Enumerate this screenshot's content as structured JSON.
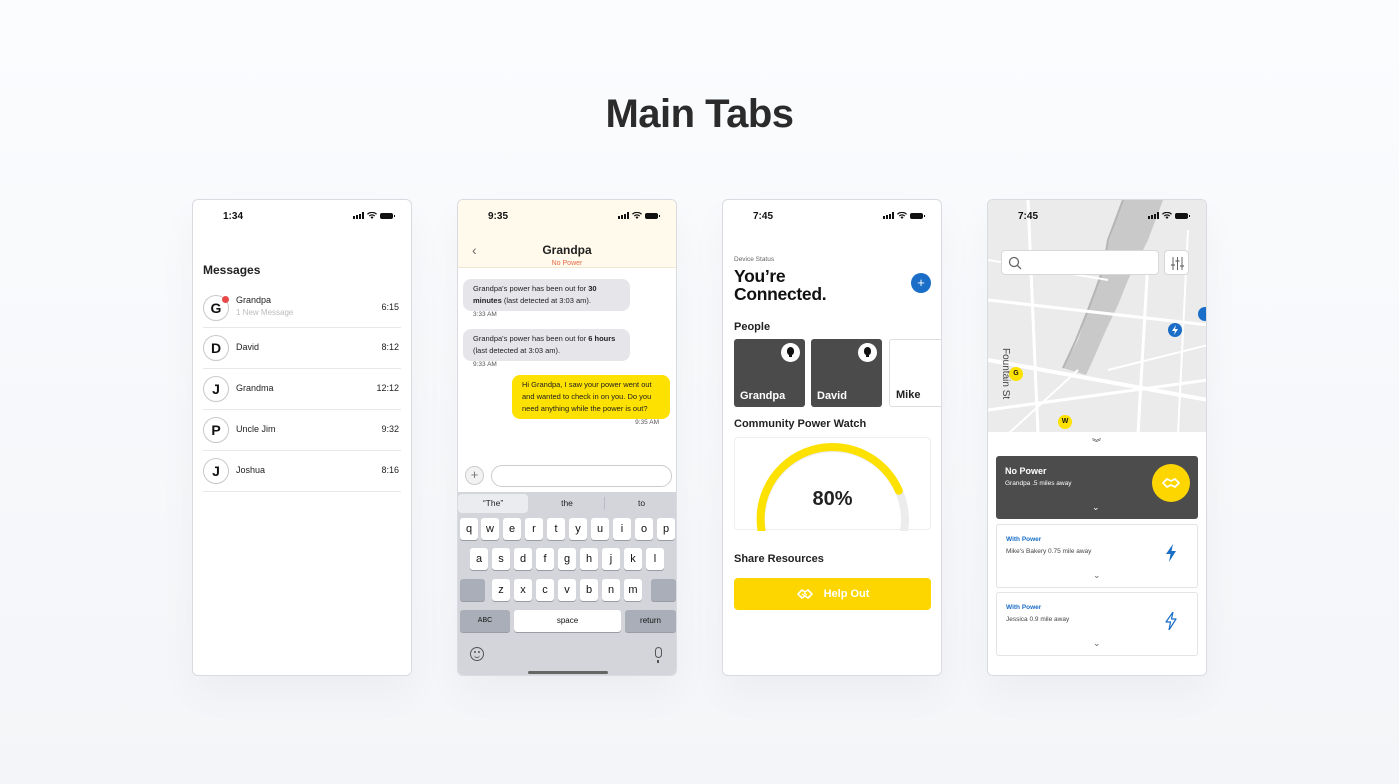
{
  "headline": "Main Tabs",
  "colors": {
    "accent_yellow": "#fde100",
    "accent_blue": "#1a6ec7",
    "dark_card": "#4b4b4b",
    "alert_red": "#e84848"
  },
  "messages_screen": {
    "time": "1:34",
    "title": "Messages",
    "conversations": [
      {
        "initial": "G",
        "name": "Grandpa",
        "subtitle": "1 New Message",
        "time": "6:15",
        "unread": true
      },
      {
        "initial": "D",
        "name": "David",
        "time": "8:12"
      },
      {
        "initial": "J",
        "name": "Grandma",
        "time": "12:12"
      },
      {
        "initial": "P",
        "name": "Uncle Jim",
        "time": "9:32"
      },
      {
        "initial": "J",
        "name": "Joshua",
        "time": "8:16"
      }
    ]
  },
  "chat_screen": {
    "time": "9:35",
    "back_icon": "chevron-left-icon",
    "contact": "Grandpa",
    "status": "No Power",
    "messages": [
      {
        "pre": "Grandpa's power has been out for ",
        "bold": "30 minutes",
        "post": " (last detected at 3:03 am).",
        "time": "3:33 AM"
      },
      {
        "pre": "Grandpa's power has been out for ",
        "bold": "6 hours",
        "post": " (last detected at 3:03 am).",
        "time": "9:33 AM"
      },
      {
        "text": "Hi Grandpa, I saw your power went out and wanted to check in on you. Do you need anything while the power is out?",
        "time": "9:35 AM"
      }
    ],
    "suggestions": [
      "“The”",
      "the",
      "to"
    ],
    "keys": {
      "row1": [
        "q",
        "w",
        "e",
        "r",
        "t",
        "y",
        "u",
        "i",
        "o",
        "p"
      ],
      "row2": [
        "a",
        "s",
        "d",
        "f",
        "g",
        "h",
        "j",
        "k",
        "l"
      ],
      "row3": [
        "z",
        "x",
        "c",
        "v",
        "b",
        "n",
        "m"
      ],
      "abc": "ABC",
      "space": "space",
      "return": "return"
    }
  },
  "status_screen": {
    "time": "7:45",
    "device_label": "Device Status",
    "headline_line1": "You’re",
    "headline_line2": "Connected.",
    "people_title": "People",
    "people": [
      {
        "name": "Grandpa",
        "power": true
      },
      {
        "name": "David",
        "power": true
      },
      {
        "name": "Mike",
        "power": false
      }
    ],
    "community_title": "Community Power Watch",
    "gauge_value": 80,
    "gauge_label": "80%",
    "share_title": "Share Resources",
    "help_button": "Help Out"
  },
  "map_screen": {
    "time": "7:45",
    "street": "Fountain St",
    "pins": [
      {
        "label": "G",
        "color": "#fde100"
      },
      {
        "label": "W",
        "color": "#fde100"
      }
    ],
    "cards": [
      {
        "title": "No Power",
        "subtitle": "Grandpa .5 miles away",
        "variant": "dark"
      },
      {
        "title": "With Power",
        "subtitle": "Mike's Bakery 0.75 mile away",
        "variant": "filled-bolt"
      },
      {
        "title": "With Power",
        "subtitle": "Jessica 0.9 mile away",
        "variant": "outline-bolt"
      }
    ]
  }
}
